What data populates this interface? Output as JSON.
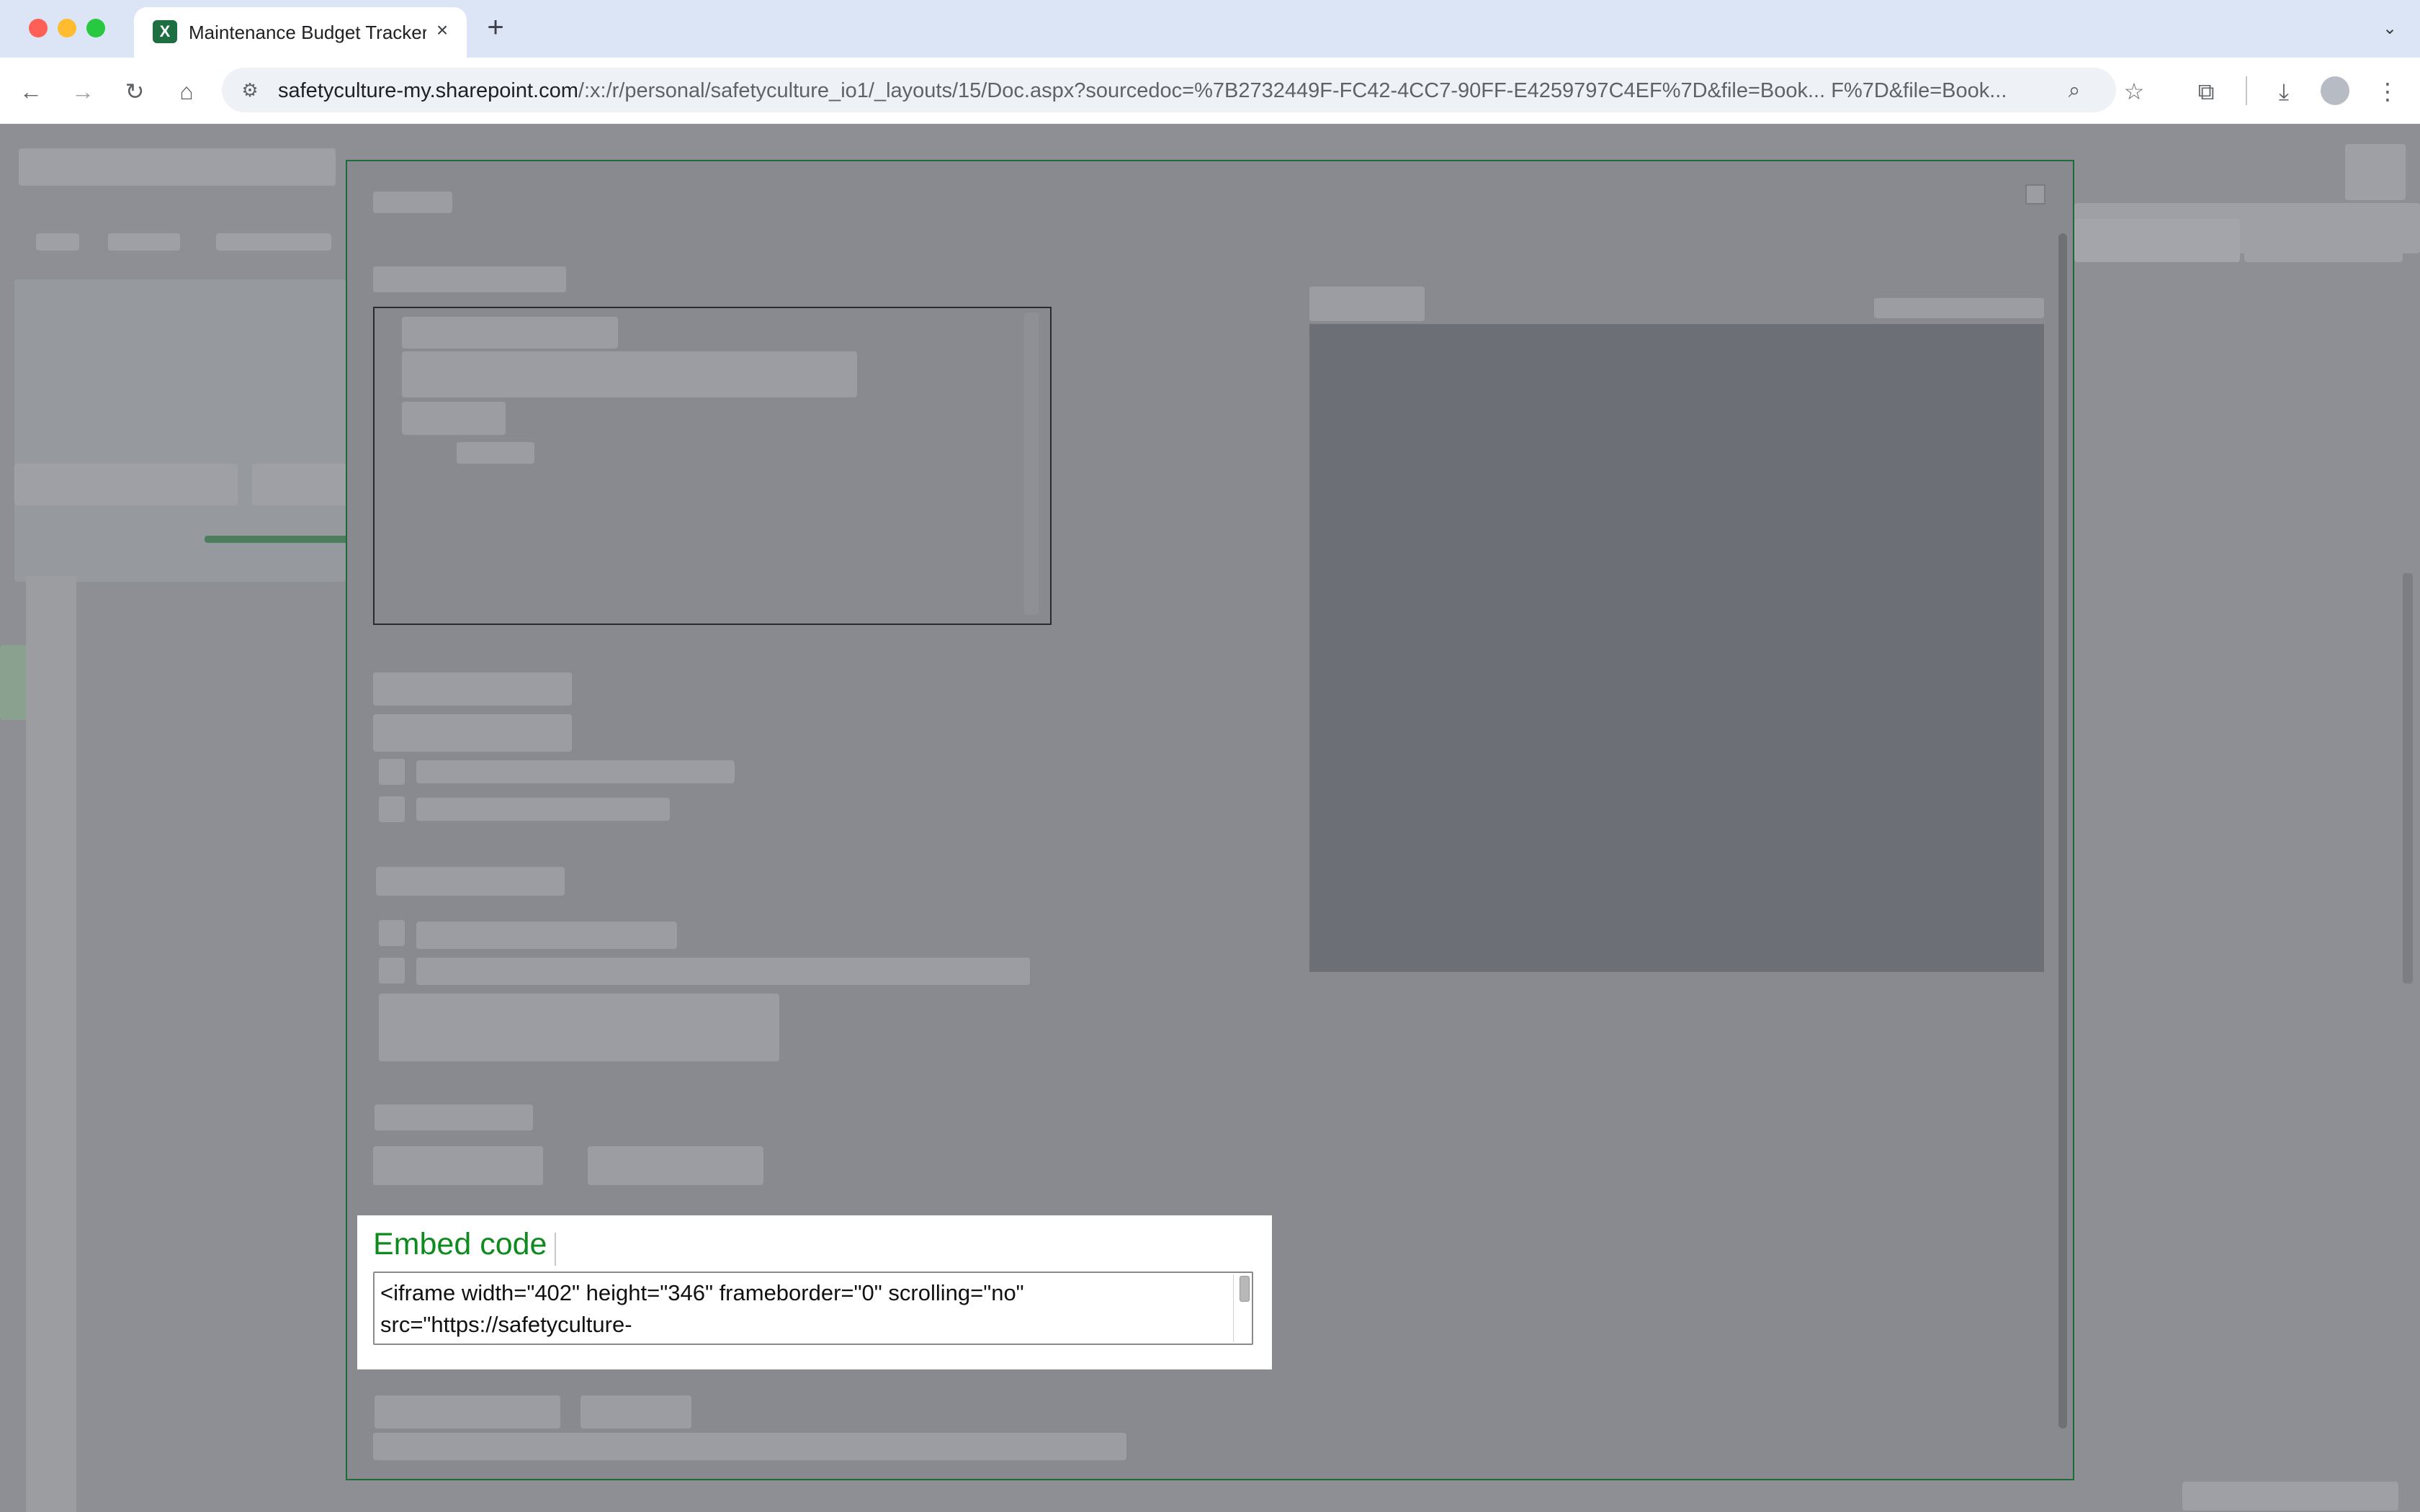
{
  "browser": {
    "tab_title": "Maintenance Budget Tracker",
    "tab_icon_letter": "X",
    "new_tab_label": "+",
    "close_tab_label": "×",
    "url_host": "safetyculture-my.sharepoint.com",
    "url_path": "/:x:/r/personal/safetyculture_io1/_layouts/15/Doc.aspx?sourcedoc=%7B2732449F-FC42-4CC7-90FF-E4259797C4EF%7D&file=Book... F%7D&file=Book...",
    "icons": [
      "back-icon",
      "forward-icon",
      "reload-icon",
      "home-icon",
      "site-info-icon",
      "zoom-icon",
      "bookmark-star-icon",
      "extensions-icon",
      "download-icon",
      "profile-icon",
      "menu-icon",
      "tab-search-icon"
    ]
  },
  "embed_dialog": {
    "section_title": "Embed code",
    "code": "<iframe width=\"402\" height=\"346\" frameborder=\"0\" scrolling=\"no\"\nsrc=\"https://safetyculture-"
  },
  "colors": {
    "accent_green": "#0e8a1e",
    "excel_green": "#1d6f42",
    "overlay_gray": "#8e8f94"
  }
}
